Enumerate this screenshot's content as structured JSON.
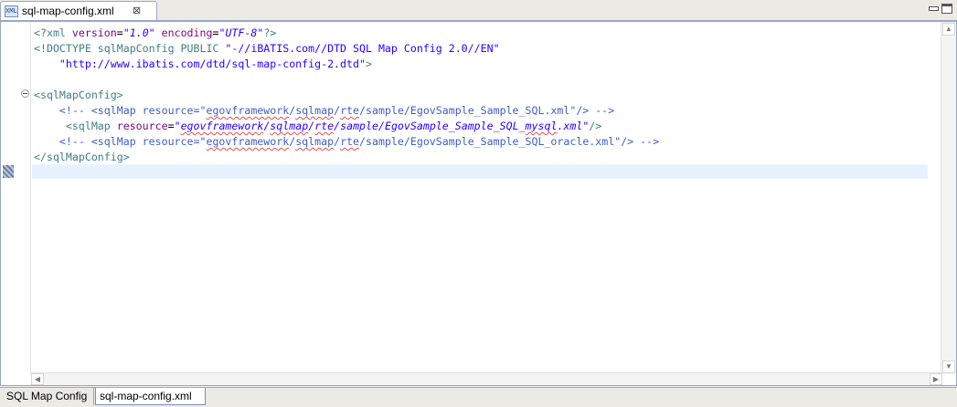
{
  "editor_tab": {
    "icon": "xml-file-icon",
    "icon_text": "XML",
    "title": "sql-map-config.xml",
    "close_glyph": "⊠"
  },
  "window_controls": {
    "minimize": "minimize-icon",
    "maximize": "maximize-icon"
  },
  "code": {
    "l1": {
      "a": "<?xml ",
      "b": "version",
      "c": "=",
      "d": "\"1.0\"",
      "e": " encoding",
      "f": "=",
      "g": "\"UTF-8\"",
      "h": "?>"
    },
    "l2": {
      "a": "<!DOCTYPE sqlMapConfig ",
      "b": "PUBLIC ",
      "c": "\"-//iBATIS.com//DTD SQL Map Config 2.0//EN\""
    },
    "l3": {
      "a": "    \"http://www.ibatis.com/dtd/sql-map-config-2.dtd\"",
      "b": ">"
    },
    "l5": {
      "a": "<sqlMapConfig>"
    },
    "l6": {
      "a": "    <!-- <sqlMap resource=\"",
      "b": "egovframework",
      "c": "/",
      "d": "sqlmap",
      "e": "/",
      "f": "rte",
      "g": "/sample/EgovSample_Sample_SQL.xml\"/> -->"
    },
    "l7": {
      "a": "     <sqlMap",
      "b": " resource",
      "c": "=",
      "d": "\"",
      "e": "egovframework",
      "f": "/",
      "g": "sqlmap",
      "h": "/",
      "i": "rte",
      "j": "/sample/EgovSample_Sample_SQL_",
      "k": "mysql",
      "l": ".xml\"",
      "m": "/>"
    },
    "l8": {
      "a": "    <!-- <sqlMap resource=\"",
      "b": "egovframework",
      "c": "/",
      "d": "sqlmap",
      "e": "/",
      "f": "rte",
      "g": "/sample/EgovSample_Sample_SQL_oracle.xml\"/> -->"
    },
    "l9": {
      "a": "</sqlMapConfig>"
    }
  },
  "bottom_tabs": {
    "design": "SQL Map Config",
    "source": "sql-map-config.xml"
  },
  "colors": {
    "tag": "#3f7f7f",
    "attribute": "#7f007f",
    "value": "#2a00ff",
    "comment": "#3f5fbf",
    "current_line": "#e8f2fe"
  }
}
